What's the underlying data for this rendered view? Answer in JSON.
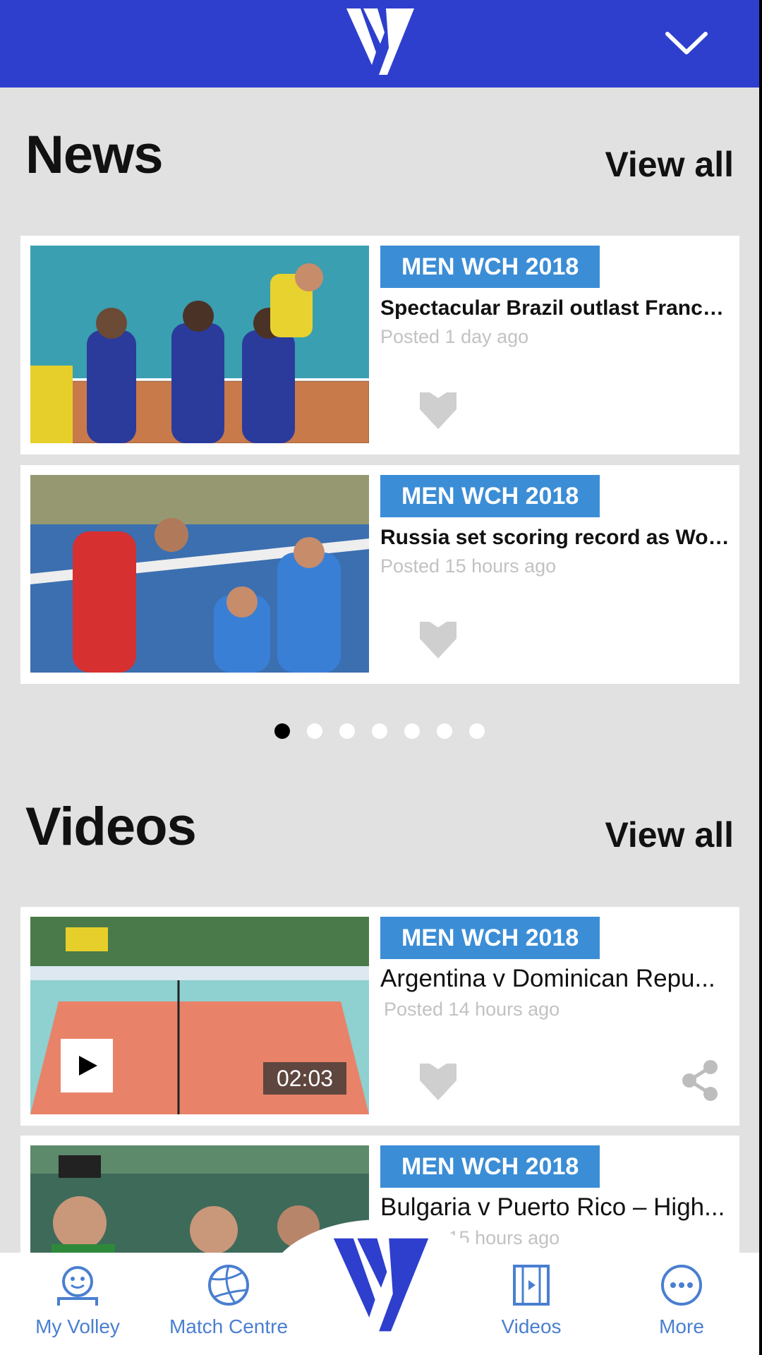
{
  "header": {
    "logo_icon": "volleyball-v-logo-icon",
    "menu_icon": "chevron-down-icon"
  },
  "news": {
    "title": "News",
    "view_all": "View all",
    "items": [
      {
        "tag": "MEN WCH 2018",
        "headline": "Spectacular Brazil outlast France,...",
        "posted": "Posted 1 day ago"
      },
      {
        "tag": "MEN WCH 2018",
        "headline": "Russia set scoring record as Worl...",
        "posted": "Posted 15 hours ago"
      }
    ],
    "pager": {
      "count": 7,
      "active_index": 0
    }
  },
  "videos": {
    "title": "Videos",
    "view_all": "View all",
    "items": [
      {
        "tag": "MEN WCH 2018",
        "headline": "Argentina v Dominican Repu...",
        "posted": "Posted 14 hours ago",
        "duration": "02:03"
      },
      {
        "tag": "MEN WCH 2018",
        "headline": "Bulgaria v Puerto Rico – High...",
        "posted": "Posted 15 hours ago"
      }
    ]
  },
  "bottom_nav": {
    "items": [
      {
        "label": "My Volley",
        "icon": "person-face-icon"
      },
      {
        "label": "Match Centre",
        "icon": "volleyball-icon"
      },
      {
        "label": "",
        "icon": "volleyball-v-logo-icon"
      },
      {
        "label": "Videos",
        "icon": "video-play-icon"
      },
      {
        "label": "More",
        "icon": "more-dots-icon"
      }
    ]
  },
  "colors": {
    "brand": "#2e3fce",
    "tag": "#3b8dd6",
    "nav_label": "#4a7fd0",
    "background": "#e1e1e1"
  }
}
